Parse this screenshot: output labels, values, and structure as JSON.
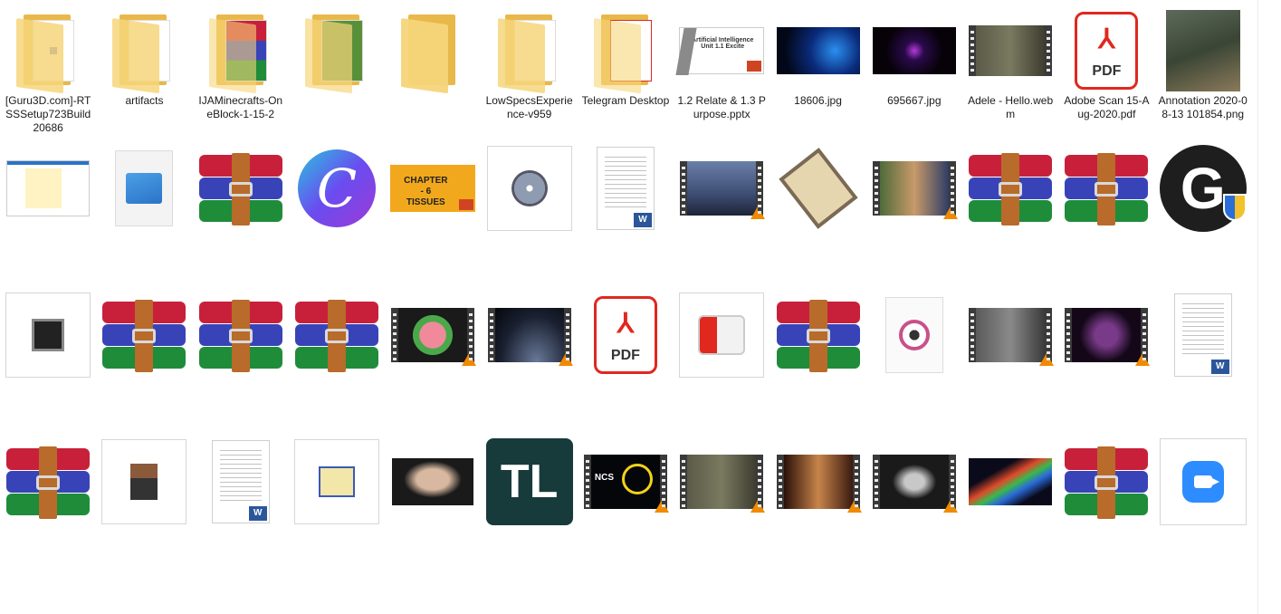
{
  "colors": {
    "folder": "#f6d57a",
    "pdf_red": "#e0281e",
    "winrar_red": "#c8203a",
    "winrar_blue": "#3943b8",
    "winrar_green": "#1f8c3a",
    "zoom_blue": "#2d8cff"
  },
  "row1": [
    {
      "label": "[Guru3D.com]-RTSSSetup723Build20686",
      "icon": "folder-icon"
    },
    {
      "label": "artifacts",
      "icon": "folder-icon"
    },
    {
      "label": "IJAMinecrafts-OneBlock-1-15-2",
      "icon": "folder-icon"
    },
    {
      "label": "",
      "icon": "folder-icon"
    },
    {
      "label": "",
      "icon": "folder-icon"
    },
    {
      "label": "LowSpecsExperience-v959",
      "icon": "folder-icon"
    },
    {
      "label": "Telegram Desktop",
      "icon": "folder-icon"
    },
    {
      "label": "1.2 Relate & 1.3 Purpose.pptx",
      "icon": "pptx-thumbnail"
    },
    {
      "label": "18606.jpg",
      "icon": "image-thumbnail"
    },
    {
      "label": "695667.jpg",
      "icon": "image-thumbnail"
    },
    {
      "label": "Adele - Hello.webm",
      "icon": "video-thumbnail"
    },
    {
      "label": "Adobe Scan 15-Aug-2020.pdf",
      "icon": "pdf-icon"
    },
    {
      "label": "Annotation 2020-08-13 101854.png",
      "icon": "image-thumbnail"
    }
  ],
  "pdf_text": "PDF",
  "chapter_text": "CHAPTER - 6 TISSUES",
  "slide_text": "Artificial Intelligence Unit 1.1 Excite",
  "canva_letter": "C",
  "logi_letter": "G",
  "tl_text": "TL",
  "ncs_text": "NCS",
  "word_badge": "W"
}
